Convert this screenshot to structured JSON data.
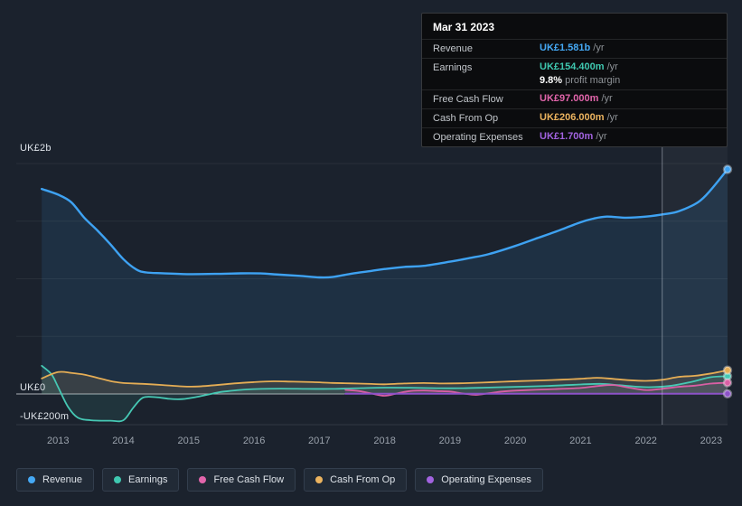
{
  "page": {
    "bg": "#1b222d"
  },
  "y_axis": {
    "top_label": "UK£2b",
    "zero_label": "UK£0",
    "bottom_label": "-UK£200m"
  },
  "x_axis": {
    "ticks": [
      "2013",
      "2014",
      "2015",
      "2016",
      "2017",
      "2018",
      "2019",
      "2020",
      "2021",
      "2022",
      "2023"
    ]
  },
  "tooltip": {
    "date": "Mar 31 2023",
    "rows": [
      {
        "label": "Revenue",
        "value": "UK£1.581b",
        "suffix": "/yr",
        "color": "#45a9f5"
      },
      {
        "label": "Earnings",
        "value": "UK£154.400m",
        "suffix": "/yr",
        "color": "#3fc8b0",
        "extra_value": "9.8%",
        "extra_label": "profit margin"
      },
      {
        "label": "Free Cash Flow",
        "value": "UK£97.000m",
        "suffix": "/yr",
        "color": "#e265ab"
      },
      {
        "label": "Cash From Op",
        "value": "UK£206.000m",
        "suffix": "/yr",
        "color": "#ecb45f"
      },
      {
        "label": "Operating Expenses",
        "value": "UK£1.700m",
        "suffix": "/yr",
        "color": "#a263e0"
      }
    ]
  },
  "legend": {
    "items": [
      {
        "label": "Revenue",
        "color": "#45a9f5"
      },
      {
        "label": "Earnings",
        "color": "#3fc8b0"
      },
      {
        "label": "Free Cash Flow",
        "color": "#e265ab"
      },
      {
        "label": "Cash From Op",
        "color": "#ecb45f"
      },
      {
        "label": "Operating Expenses",
        "color": "#a263e0"
      }
    ]
  },
  "chart_data": {
    "type": "area",
    "title": "Earnings and Revenue History",
    "x_unit": "year",
    "y_unit": "UK£m",
    "xlim": [
      2012.36,
      2023.25
    ],
    "ylim": [
      -290,
      2000
    ],
    "gridlines_m": [
      2000,
      1500,
      1000,
      500,
      0
    ],
    "crosshair_year": 2022.25,
    "grid": true,
    "legend_position": "bottom",
    "series": [
      {
        "name": "Revenue",
        "color": "#3ea2f2",
        "fill": "rgba(59,160,234,0.12)",
        "width": 2.4,
        "points": [
          [
            2012.75,
            1780
          ],
          [
            2013.0,
            1730
          ],
          [
            2013.2,
            1665
          ],
          [
            2013.4,
            1530
          ],
          [
            2013.6,
            1420
          ],
          [
            2013.8,
            1300
          ],
          [
            2014.0,
            1170
          ],
          [
            2014.2,
            1080
          ],
          [
            2014.35,
            1055
          ],
          [
            2014.6,
            1048
          ],
          [
            2015.0,
            1040
          ],
          [
            2015.4,
            1042
          ],
          [
            2015.8,
            1047
          ],
          [
            2016.1,
            1046
          ],
          [
            2016.4,
            1035
          ],
          [
            2016.7,
            1025
          ],
          [
            2017.0,
            1012
          ],
          [
            2017.2,
            1015
          ],
          [
            2017.5,
            1045
          ],
          [
            2017.8,
            1068
          ],
          [
            2018.0,
            1085
          ],
          [
            2018.3,
            1103
          ],
          [
            2018.6,
            1112
          ],
          [
            2019.0,
            1148
          ],
          [
            2019.3,
            1180
          ],
          [
            2019.6,
            1215
          ],
          [
            2020.0,
            1285
          ],
          [
            2020.3,
            1345
          ],
          [
            2020.6,
            1405
          ],
          [
            2021.0,
            1490
          ],
          [
            2021.2,
            1522
          ],
          [
            2021.4,
            1540
          ],
          [
            2021.7,
            1530
          ],
          [
            2022.0,
            1540
          ],
          [
            2022.3,
            1562
          ],
          [
            2022.5,
            1585
          ],
          [
            2022.8,
            1665
          ],
          [
            2023.0,
            1775
          ],
          [
            2023.25,
            1950
          ]
        ]
      },
      {
        "name": "Earnings",
        "color": "#46c8b4",
        "fill": "rgba(69,200,178,0.11)",
        "width": 1.8,
        "points": [
          [
            2012.75,
            245
          ],
          [
            2012.9,
            170
          ],
          [
            2013.0,
            60
          ],
          [
            2013.15,
            -110
          ],
          [
            2013.3,
            -205
          ],
          [
            2013.5,
            -228
          ],
          [
            2013.8,
            -232
          ],
          [
            2014.0,
            -228
          ],
          [
            2014.15,
            -120
          ],
          [
            2014.3,
            -32
          ],
          [
            2014.5,
            -28
          ],
          [
            2014.7,
            -42
          ],
          [
            2014.9,
            -45
          ],
          [
            2015.1,
            -28
          ],
          [
            2015.3,
            -5
          ],
          [
            2015.5,
            18
          ],
          [
            2015.8,
            35
          ],
          [
            2016.0,
            42
          ],
          [
            2016.4,
            46
          ],
          [
            2016.8,
            44
          ],
          [
            2017.2,
            44
          ],
          [
            2017.6,
            50
          ],
          [
            2018.0,
            55
          ],
          [
            2018.4,
            54
          ],
          [
            2018.8,
            50
          ],
          [
            2019.2,
            50
          ],
          [
            2019.6,
            56
          ],
          [
            2020.0,
            62
          ],
          [
            2020.5,
            70
          ],
          [
            2021.0,
            82
          ],
          [
            2021.3,
            88
          ],
          [
            2021.6,
            76
          ],
          [
            2021.9,
            62
          ],
          [
            2022.1,
            60
          ],
          [
            2022.4,
            72
          ],
          [
            2022.7,
            105
          ],
          [
            2023.0,
            146
          ],
          [
            2023.25,
            154
          ]
        ]
      },
      {
        "name": "Cash From Op",
        "color": "#e5ad55",
        "fill": "rgba(233,179,95,0.13)",
        "width": 1.8,
        "points": [
          [
            2012.75,
            135
          ],
          [
            2013.0,
            190
          ],
          [
            2013.2,
            183
          ],
          [
            2013.4,
            168
          ],
          [
            2013.6,
            140
          ],
          [
            2013.8,
            112
          ],
          [
            2014.0,
            95
          ],
          [
            2014.3,
            88
          ],
          [
            2014.6,
            78
          ],
          [
            2014.9,
            66
          ],
          [
            2015.1,
            64
          ],
          [
            2015.4,
            76
          ],
          [
            2015.7,
            92
          ],
          [
            2016.0,
            103
          ],
          [
            2016.3,
            110
          ],
          [
            2016.6,
            107
          ],
          [
            2016.9,
            103
          ],
          [
            2017.2,
            96
          ],
          [
            2017.5,
            92
          ],
          [
            2017.8,
            87
          ],
          [
            2018.0,
            84
          ],
          [
            2018.3,
            91
          ],
          [
            2018.6,
            95
          ],
          [
            2018.9,
            91
          ],
          [
            2019.2,
            93
          ],
          [
            2019.5,
            99
          ],
          [
            2019.8,
            106
          ],
          [
            2020.1,
            112
          ],
          [
            2020.4,
            118
          ],
          [
            2020.7,
            124
          ],
          [
            2021.0,
            132
          ],
          [
            2021.25,
            140
          ],
          [
            2021.5,
            131
          ],
          [
            2021.75,
            119
          ],
          [
            2022.0,
            114
          ],
          [
            2022.25,
            123
          ],
          [
            2022.5,
            148
          ],
          [
            2022.75,
            158
          ],
          [
            2023.0,
            178
          ],
          [
            2023.25,
            206
          ]
        ]
      },
      {
        "name": "Free Cash Flow",
        "color": "#d95fa4",
        "fill": "rgba(224,102,166,0.09)",
        "width": 1.8,
        "points": [
          [
            2017.4,
            35
          ],
          [
            2017.6,
            26
          ],
          [
            2017.8,
            4
          ],
          [
            2018.0,
            -16
          ],
          [
            2018.2,
            6
          ],
          [
            2018.4,
            26
          ],
          [
            2018.6,
            30
          ],
          [
            2018.8,
            25
          ],
          [
            2019.0,
            21
          ],
          [
            2019.2,
            4
          ],
          [
            2019.4,
            -8
          ],
          [
            2019.6,
            6
          ],
          [
            2019.8,
            21
          ],
          [
            2020.0,
            29
          ],
          [
            2020.3,
            36
          ],
          [
            2020.6,
            42
          ],
          [
            2021.0,
            52
          ],
          [
            2021.25,
            68
          ],
          [
            2021.5,
            78
          ],
          [
            2021.75,
            54
          ],
          [
            2022.0,
            34
          ],
          [
            2022.25,
            45
          ],
          [
            2022.5,
            62
          ],
          [
            2022.75,
            72
          ],
          [
            2023.0,
            90
          ],
          [
            2023.25,
            97
          ]
        ]
      },
      {
        "name": "Operating Expenses",
        "color": "#8c52c8",
        "fill": null,
        "width": 2.0,
        "points": [
          [
            2017.4,
            1.7
          ],
          [
            2020.0,
            1.7
          ],
          [
            2023.25,
            1.7
          ]
        ]
      }
    ]
  }
}
